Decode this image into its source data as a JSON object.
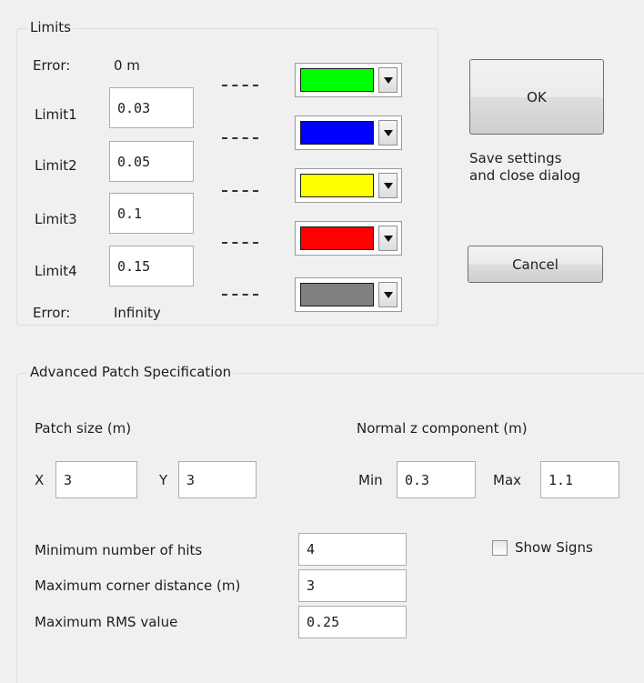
{
  "limits": {
    "title": "Limits",
    "error_top_label": "Error:",
    "error_top_value": "0 m",
    "rows": [
      {
        "label": "Limit1",
        "value": "0.03"
      },
      {
        "label": "Limit2",
        "value": "0.05"
      },
      {
        "label": "Limit3",
        "value": "0.1"
      },
      {
        "label": "Limit4",
        "value": "0.15"
      }
    ],
    "error_bottom_label": "Error:",
    "error_bottom_value": "Infinity",
    "colors": [
      {
        "name": "green",
        "hex": "#00ff00"
      },
      {
        "name": "blue",
        "hex": "#0000ff"
      },
      {
        "name": "yellow",
        "hex": "#ffff00"
      },
      {
        "name": "red",
        "hex": "#ff0000"
      },
      {
        "name": "gray",
        "hex": "#808080"
      }
    ]
  },
  "buttons": {
    "ok_label": "OK",
    "ok_description_line1": "Save settings",
    "ok_description_line2": "and close dialog",
    "cancel_label": "Cancel"
  },
  "advanced": {
    "title": "Advanced Patch Specification",
    "patch_size_label": "Patch size (m)",
    "x_label": "X",
    "x_value": "3",
    "y_label": "Y",
    "y_value": "3",
    "normal_label": "Normal z component (m)",
    "min_label": "Min",
    "min_value": "0.3",
    "max_label": "Max",
    "max_value": "1.1",
    "min_hits_label": "Minimum number of hits",
    "min_hits_value": "4",
    "show_signs_label": "Show Signs",
    "max_corner_label": "Maximum corner distance (m)",
    "max_corner_value": "3",
    "max_rms_label": "Maximum RMS value",
    "max_rms_value": "0.25"
  }
}
